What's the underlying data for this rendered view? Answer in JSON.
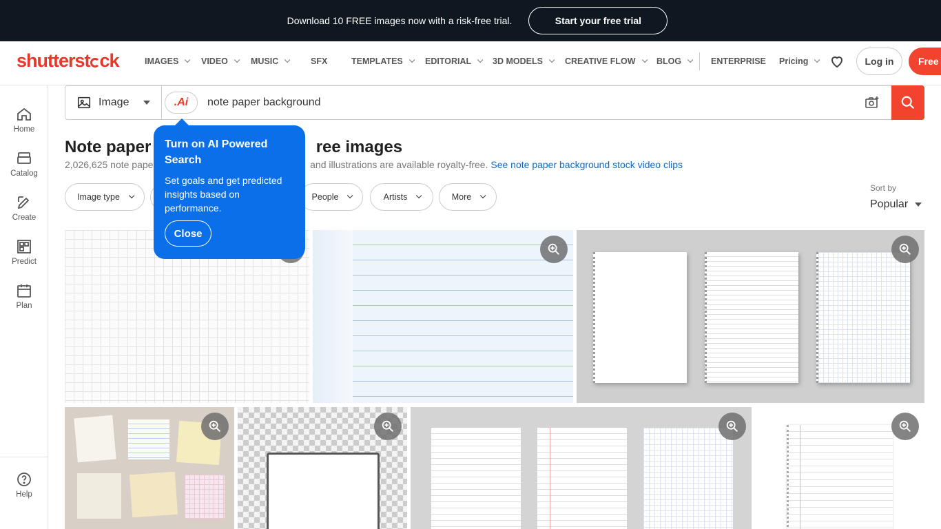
{
  "promo": {
    "text": "Download 10 FREE images now with a risk-free trial.",
    "cta": "Start your free trial"
  },
  "brand": {
    "name_a": "shutterst",
    "name_b": "ck",
    "accent": "#e9382a"
  },
  "nav": {
    "items": [
      "IMAGES",
      "VIDEO",
      "MUSIC",
      "SFX",
      "TEMPLATES",
      "EDITORIAL",
      "3D MODELS",
      "CREATIVE FLOW",
      "BLOG",
      "ENTERPRISE",
      "Pricing"
    ],
    "login": "Log in",
    "free": "Free t"
  },
  "sidebar": {
    "items": [
      "Home",
      "Catalog",
      "Create",
      "Predict",
      "Plan"
    ],
    "help": "Help"
  },
  "search": {
    "type": "Image",
    "ai_label": ".Ai",
    "query": "note paper background"
  },
  "results": {
    "heading_a": "Note paper b",
    "heading_b": "ree images",
    "count_a": "2,026,625 note paper",
    "count_b": "and illustrations are available royalty-free.",
    "link": "See note paper background stock video clips"
  },
  "filters": [
    "Image type",
    "People",
    "Artists",
    "More"
  ],
  "sort": {
    "label": "Sort by",
    "value": "Popular"
  },
  "popup": {
    "title": "Turn on AI Powered Search",
    "body": "Set goals and get predicted insights based on performance.",
    "close": "Close"
  }
}
